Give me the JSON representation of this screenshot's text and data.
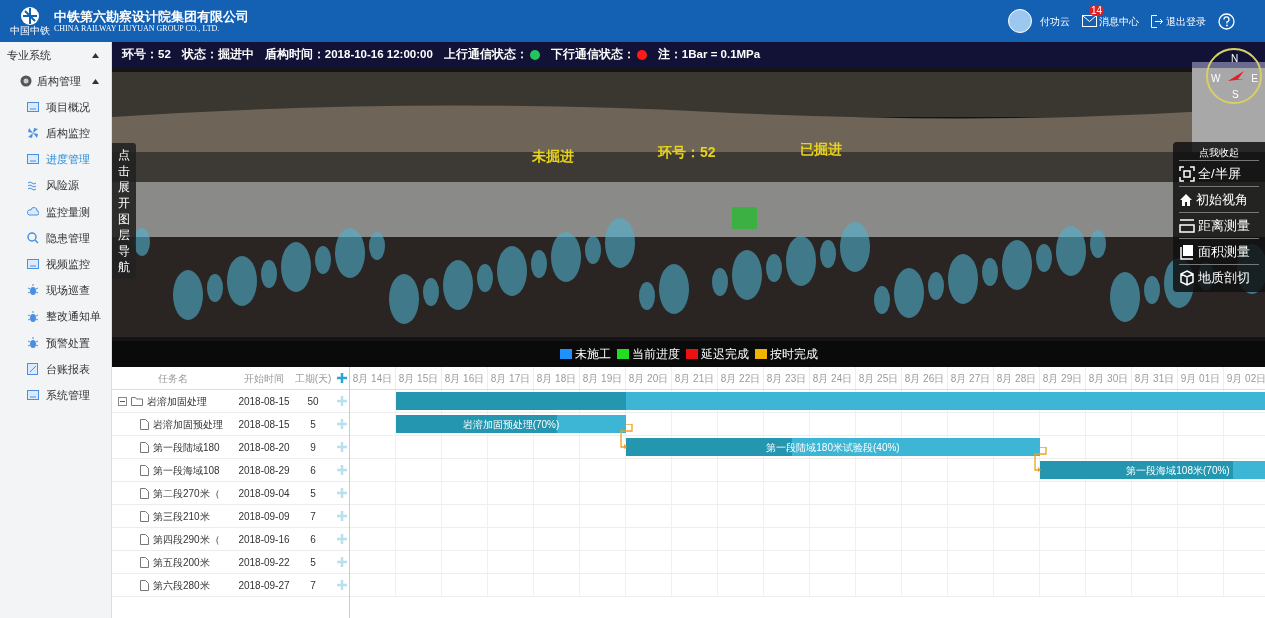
{
  "header": {
    "logo_caption": "中国中铁",
    "title": "中铁第六勘察设计院集团有限公司",
    "subtitle": "CHINA  RAILWAY LIUYUAN GROUP CO., LTD.",
    "user": "付功云",
    "messages_badge": "14",
    "messages": "消息中心",
    "logout": "退出登录"
  },
  "sidebar": {
    "title": "专业系统",
    "expanded": true,
    "group": {
      "label": "盾构管理",
      "expanded": true,
      "items": [
        {
          "label": "项目概况",
          "selected": false
        },
        {
          "label": "盾构监控",
          "selected": false
        },
        {
          "label": "进度管理",
          "selected": true
        },
        {
          "label": "风险源",
          "selected": false
        },
        {
          "label": "监控量测",
          "selected": false
        },
        {
          "label": "隐患管理",
          "selected": false
        },
        {
          "label": "视频监控",
          "selected": false
        },
        {
          "label": "现场巡查",
          "selected": false
        },
        {
          "label": "整改通知单",
          "selected": false
        },
        {
          "label": "预警处置",
          "selected": false
        },
        {
          "label": "台账报表",
          "selected": false
        },
        {
          "label": "系统管理",
          "selected": false
        }
      ]
    }
  },
  "status_bar": [
    {
      "text": "环号：52"
    },
    {
      "text": "状态：掘进中"
    },
    {
      "text": "盾构时间：2018-10-16 12:00:00"
    },
    {
      "text": "上行通信状态：",
      "color": "#22c55e"
    },
    {
      "text": "下行通信状态：",
      "color": "#ff1a1a"
    },
    {
      "text": "注：1Bar = 0.1MPa"
    }
  ],
  "scene": {
    "left_label": "未掘进",
    "ring_label": "环号：52",
    "right_label": "已掘进",
    "layer_nav": "点击展开图层导航"
  },
  "compass": {
    "n": "N",
    "s": "S",
    "w": "W",
    "e": "E"
  },
  "tools": {
    "collapse": "点我收起",
    "items": [
      {
        "kind": "fullscreen",
        "label": "全/半屏"
      },
      {
        "kind": "home",
        "label": "初始视角"
      },
      {
        "kind": "ruler",
        "label": "距离测量"
      },
      {
        "kind": "area",
        "label": "面积测量"
      },
      {
        "kind": "cube",
        "label": "地质剖切"
      }
    ]
  },
  "legend": [
    {
      "label": "未施工",
      "color": "#1e90ff"
    },
    {
      "label": "当前进度",
      "color": "#22dd22"
    },
    {
      "label": "延迟完成",
      "color": "#ee1111"
    },
    {
      "label": "按时完成",
      "color": "#f0b400"
    }
  ],
  "gantt": {
    "columns": [
      "任务名",
      "开始时间",
      "工期(天)"
    ],
    "days": [
      "8月 14日",
      "8月 15日",
      "8月 16日",
      "8月 17日",
      "8月 18日",
      "8月 19日",
      "8月 20日",
      "8月 21日",
      "8月 22日",
      "8月 23日",
      "8月 24日",
      "8月 25日",
      "8月 26日",
      "8月 27日",
      "8月 28日",
      "8月 29日",
      "8月 30日",
      "8月 31日",
      "9月 01日",
      "9月 02日"
    ],
    "tasks": [
      {
        "name": "岩溶加固处理",
        "start": "2018-08-15",
        "duration": "50",
        "expanded": true,
        "bar": {
          "level": 0.1
        },
        "children": [
          {
            "name": "岩溶加固预处理",
            "start": "2018-08-15",
            "duration": "5",
            "bar": {
              "label": "岩溶加固预处理(70%)",
              "level": 0.7
            }
          },
          {
            "name": "第一段陆域180",
            "start": "2018-08-20",
            "duration": "9",
            "bar": {
              "label": "第一段陆域180米试验段(40%)",
              "level": 0.4
            }
          },
          {
            "name": "第一段海域108",
            "start": "2018-08-29",
            "duration": "6",
            "bar": {
              "label": "第一段海域108米(70%)",
              "level": 0.7
            }
          },
          {
            "name": "第二段270米（",
            "start": "2018-09-04",
            "duration": "5"
          },
          {
            "name": "第三段210米",
            "start": "2018-09-09",
            "duration": "7"
          },
          {
            "name": "第四段290米（",
            "start": "2018-09-16",
            "duration": "6"
          },
          {
            "name": "第五段200米",
            "start": "2018-09-22",
            "duration": "5"
          },
          {
            "name": "第六段280米",
            "start": "2018-09-27",
            "duration": "7"
          }
        ]
      }
    ]
  }
}
